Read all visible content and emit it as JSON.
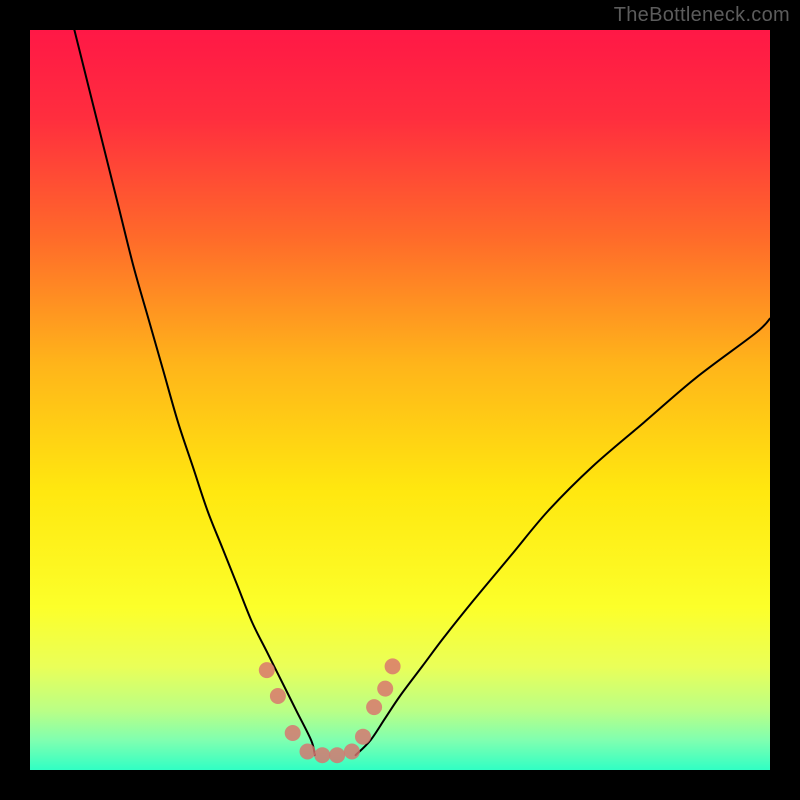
{
  "watermark": "TheBottleneck.com",
  "chart_data": {
    "type": "line",
    "title": "",
    "xlabel": "",
    "ylabel": "",
    "xlim": [
      0,
      100
    ],
    "ylim": [
      0,
      100
    ],
    "grid": false,
    "legend": false,
    "annotations": [],
    "background_gradient_stops": [
      {
        "pos": 0.0,
        "color": "#ff1846"
      },
      {
        "pos": 0.12,
        "color": "#ff2e3e"
      },
      {
        "pos": 0.28,
        "color": "#ff6a2a"
      },
      {
        "pos": 0.45,
        "color": "#ffb41a"
      },
      {
        "pos": 0.62,
        "color": "#ffe70f"
      },
      {
        "pos": 0.78,
        "color": "#fcff2a"
      },
      {
        "pos": 0.86,
        "color": "#eaff58"
      },
      {
        "pos": 0.92,
        "color": "#baff86"
      },
      {
        "pos": 0.96,
        "color": "#7fffb0"
      },
      {
        "pos": 1.0,
        "color": "#30ffc4"
      }
    ],
    "series": [
      {
        "name": "bottleneck-curve-left",
        "color": "#000000",
        "stroke_width": 2,
        "x": [
          6,
          8,
          10,
          12,
          14,
          16,
          18,
          20,
          22,
          24,
          26,
          28,
          30,
          32,
          34,
          36,
          38,
          38.5
        ],
        "y": [
          100,
          92,
          84,
          76,
          68,
          61,
          54,
          47,
          41,
          35,
          30,
          25,
          20,
          16,
          12,
          8,
          4,
          2
        ]
      },
      {
        "name": "bottleneck-curve-right",
        "color": "#000000",
        "stroke_width": 2,
        "x": [
          44,
          46,
          48,
          50,
          53,
          56,
          60,
          65,
          70,
          76,
          83,
          90,
          98,
          100
        ],
        "y": [
          2,
          4,
          7,
          10,
          14,
          18,
          23,
          29,
          35,
          41,
          47,
          53,
          59,
          61
        ]
      },
      {
        "name": "marker-band",
        "type": "scatter",
        "color": "#d9736e",
        "marker_size": 16,
        "x": [
          32.0,
          33.5,
          35.5,
          37.5,
          39.5,
          41.5,
          43.5,
          45.0,
          46.5,
          48.0,
          49.0
        ],
        "y": [
          13.5,
          10.0,
          5.0,
          2.5,
          2.0,
          2.0,
          2.5,
          4.5,
          8.5,
          11.0,
          14.0
        ]
      }
    ]
  }
}
